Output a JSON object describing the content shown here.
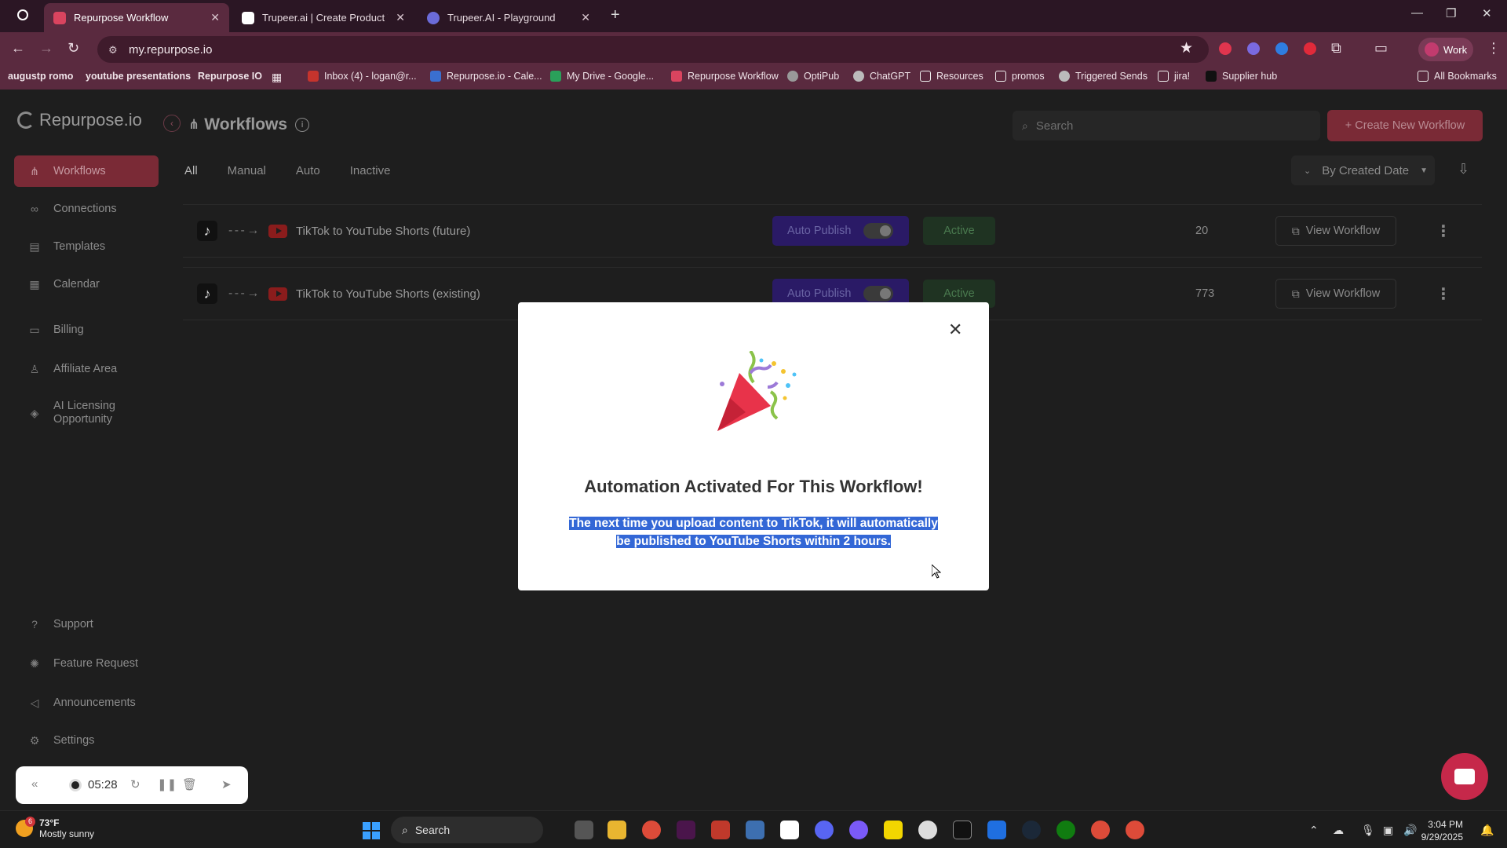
{
  "browser": {
    "tabs": [
      {
        "title": "Repurpose Workflow",
        "active": true
      },
      {
        "title": "Trupeer.ai | Create Product Vide",
        "active": false
      },
      {
        "title": "Trupeer.AI - Playground",
        "active": false
      }
    ],
    "url": "my.repurpose.io",
    "profile_label": "Work",
    "bookmarks": [
      "augustp romo",
      "youtube presentations",
      "Repurpose IO",
      "Inbox (4) - logan@r...",
      "Repurpose.io - Cale...",
      "My Drive - Google...",
      "Repurpose Workflow",
      "OptiPub",
      "ChatGPT",
      "Resources",
      "promos",
      "Triggered Sends",
      "jira!",
      "Supplier hub",
      "All Bookmarks"
    ]
  },
  "app": {
    "logo_text": "Repurpose.io",
    "page_title": "Workflows",
    "search_placeholder": "Search",
    "create_button": "+ Create New Workflow",
    "sidebar": {
      "items": [
        {
          "label": "Workflows",
          "icon": "workflow-icon",
          "active": true
        },
        {
          "label": "Connections",
          "icon": "link-icon"
        },
        {
          "label": "Templates",
          "icon": "template-icon"
        },
        {
          "label": "Calendar",
          "icon": "calendar-icon"
        },
        {
          "label": "Billing",
          "icon": "card-icon"
        },
        {
          "label": "Affiliate Area",
          "icon": "affiliate-icon"
        },
        {
          "label": "AI Licensing Opportunity",
          "icon": "license-icon"
        },
        {
          "label": "Support",
          "icon": "help-icon"
        },
        {
          "label": "Feature Request",
          "icon": "bulb-icon"
        },
        {
          "label": "Announcements",
          "icon": "megaphone-icon"
        },
        {
          "label": "Settings",
          "icon": "gear-icon"
        }
      ]
    },
    "filter_tabs": [
      "All",
      "Manual",
      "Auto",
      "Inactive"
    ],
    "sort_label": "By Created Date",
    "workflows": [
      {
        "name": "TikTok to YouTube Shorts (future)",
        "auto_publish": "Auto Publish",
        "status": "Active",
        "count": "20",
        "view": "View Workflow"
      },
      {
        "name": "TikTok to YouTube Shorts (existing)",
        "auto_publish": "Auto Publish",
        "status": "Active",
        "count": "773",
        "view": "View Workflow"
      }
    ]
  },
  "modal": {
    "title": "Automation Activated For This Workflow!",
    "body_line1": "The next time you upload content to TikTok, it will automatically",
    "body_line2": "be published to YouTube Shorts within 2 hours."
  },
  "recorder": {
    "time": "05:28"
  },
  "taskbar": {
    "weather_temp": "73°F",
    "weather_desc": "Mostly sunny",
    "weather_badge": "6",
    "search_label": "Search",
    "time": "3:04 PM",
    "date": "9/29/2025"
  },
  "colors": {
    "accent": "#7a2a36",
    "chrome": "#5a2a3f",
    "selection": "#3367d6",
    "auto_publish_bg": "#2a1a66",
    "active_status_bg": "#1f3322"
  }
}
